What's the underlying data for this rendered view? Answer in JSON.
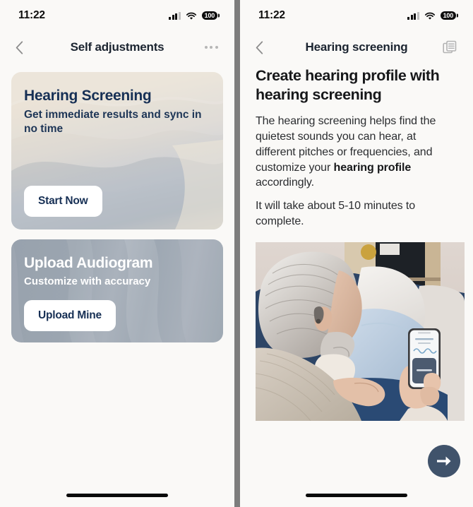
{
  "left_panel": {
    "status_bar": {
      "time": "11:22",
      "signal_icon": "cellular-signal-icon",
      "wifi_icon": "wifi-icon",
      "battery_level": "100",
      "battery_icon": "battery-icon"
    },
    "nav": {
      "back_icon": "chevron-left-icon",
      "title": "Self adjustments",
      "more_icon": "more-options-icon"
    },
    "cards": [
      {
        "id": "hearing-screening",
        "title": "Hearing Screening",
        "subtitle": "Get immediate results and sync in no time",
        "button_label": "Start Now",
        "bg_start": "#e9e1d3",
        "bg_end": "#bfc4cb",
        "text_color": "#173055"
      },
      {
        "id": "upload-audiogram",
        "title": "Upload Audiogram",
        "subtitle": "Customize with accuracy",
        "button_label": "Upload Mine",
        "bg_start": "#98a2ad",
        "bg_end": "#9aa4af",
        "text_color": "#ffffff"
      }
    ],
    "home_indicator": "home-indicator"
  },
  "right_panel": {
    "status_bar": {
      "time": "11:22",
      "signal_icon": "cellular-signal-icon",
      "wifi_icon": "wifi-icon",
      "battery_level": "100",
      "battery_icon": "battery-icon"
    },
    "nav": {
      "back_icon": "chevron-left-icon",
      "title": "Hearing screening",
      "library_icon": "document-library-icon"
    },
    "content": {
      "heading": "Create hearing profile with hearing screening",
      "paragraph1_part1": "The hearing screening helps find the quietest sounds you can hear, at different pitches or frequencies, and customize your ",
      "paragraph1_bold": "hearing profile",
      "paragraph1_part2": " accordingly.",
      "paragraph2": "It will take about 5-10 minutes to complete.",
      "image_alt": "Older man with gray hair wearing a hearing aid, sitting on a couch with blue pillows holding a smartphone showing a hearing app"
    },
    "next_button": {
      "icon": "arrow-right-icon",
      "color": "#40536b"
    },
    "home_indicator": "home-indicator"
  }
}
